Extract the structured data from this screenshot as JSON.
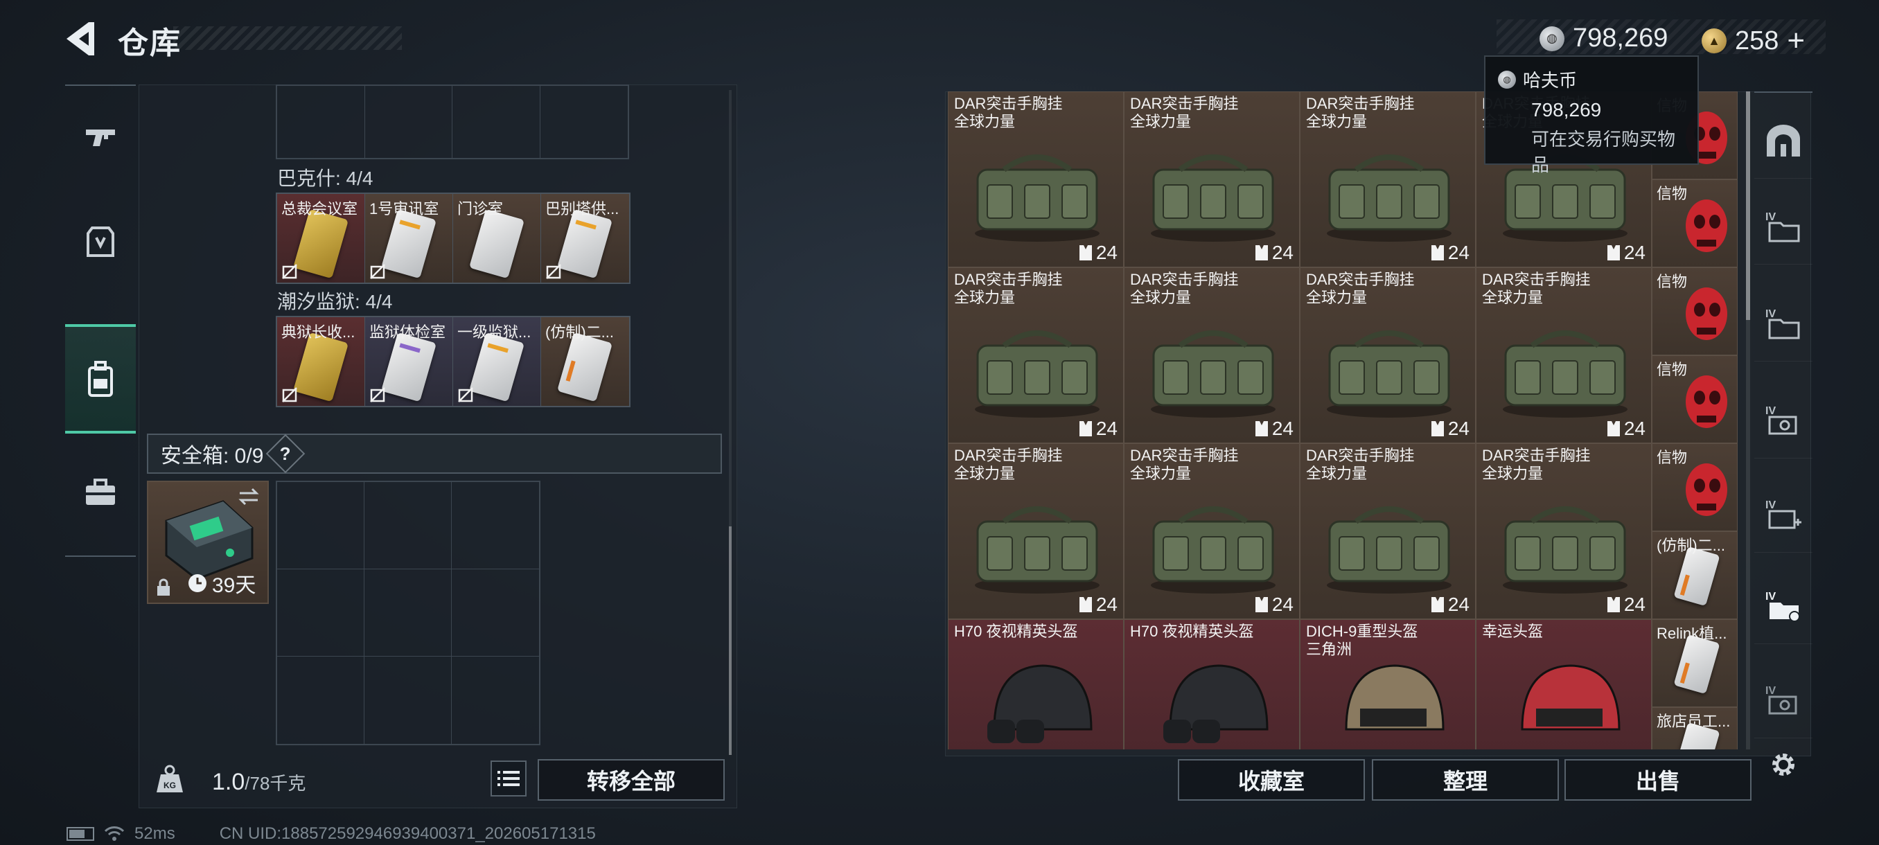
{
  "header": {
    "title": "仓库"
  },
  "currency": {
    "hafu_value": "798,269",
    "gold_value": "258",
    "plus": "+"
  },
  "tooltip": {
    "title": "哈夫币",
    "value": "798,269",
    "desc": "可在交易行购买物品"
  },
  "left": {
    "bake_label": "巴克什: 4/4",
    "bake_cards": [
      {
        "name": "总裁会议室"
      },
      {
        "name": "1号审讯室"
      },
      {
        "name": "门诊室"
      },
      {
        "name": "巴别塔供..."
      }
    ],
    "chaoxi_label": "潮汐监狱: 4/4",
    "chaoxi_cards": [
      {
        "name": "典狱长收..."
      },
      {
        "name": "监狱体检室"
      },
      {
        "name": "一级监狱..."
      },
      {
        "name": "(仿制)二..."
      }
    ],
    "safebox_label": "安全箱: 0/9",
    "safebox_help": "?",
    "safebox_days": "39天",
    "weight_value": "1.0",
    "weight_max": "/78千克",
    "transfer_all": "转移全部"
  },
  "right": {
    "rows": [
      [
        {
          "name": "DAR突击手胸挂",
          "sub": "全球力量",
          "cap": "24"
        },
        {
          "name": "DAR突击手胸挂",
          "sub": "全球力量",
          "cap": "24"
        },
        {
          "name": "DAR突击手胸挂",
          "sub": "全球力量",
          "cap": "24"
        },
        {
          "name": "DAR突击手胸挂",
          "sub": "全球力量",
          "cap": "24"
        }
      ],
      [
        {
          "name": "DAR突击手胸挂",
          "sub": "全球力量",
          "cap": "24"
        },
        {
          "name": "DAR突击手胸挂",
          "sub": "全球力量",
          "cap": "24"
        },
        {
          "name": "DAR突击手胸挂",
          "sub": "全球力量",
          "cap": "24"
        },
        {
          "name": "DAR突击手胸挂",
          "sub": "全球力量",
          "cap": "24"
        }
      ],
      [
        {
          "name": "DAR突击手胸挂",
          "sub": "全球力量",
          "cap": "24"
        },
        {
          "name": "DAR突击手胸挂",
          "sub": "全球力量",
          "cap": "24"
        },
        {
          "name": "DAR突击手胸挂",
          "sub": "全球力量",
          "cap": "24"
        },
        {
          "name": "DAR突击手胸挂",
          "sub": "全球力量",
          "cap": "24"
        }
      ]
    ],
    "helmets": [
      {
        "name": "H70 夜视精英头盔",
        "sub": ""
      },
      {
        "name": "H70 夜视精英头盔",
        "sub": ""
      },
      {
        "name": "DICH-9重型头盔",
        "sub": "三角洲"
      },
      {
        "name": "幸运头盔",
        "sub": ""
      }
    ],
    "side_items": [
      {
        "name": "信物"
      },
      {
        "name": "信物"
      },
      {
        "name": "信物"
      },
      {
        "name": "信物"
      },
      {
        "name": "信物"
      },
      {
        "name": "(仿制)二..."
      },
      {
        "name": "Relink植..."
      },
      {
        "name": "旅店员工..."
      }
    ],
    "btn_collection": "收藏室",
    "btn_sort": "整理",
    "btn_sell": "出售"
  },
  "status": {
    "ping": "52ms",
    "uid": "CN UID:188572592946939400371_202605171315"
  },
  "colors": {
    "accent": "#4ec9a6",
    "item_brown": "#4d3f35",
    "item_red": "#5c2d33"
  }
}
